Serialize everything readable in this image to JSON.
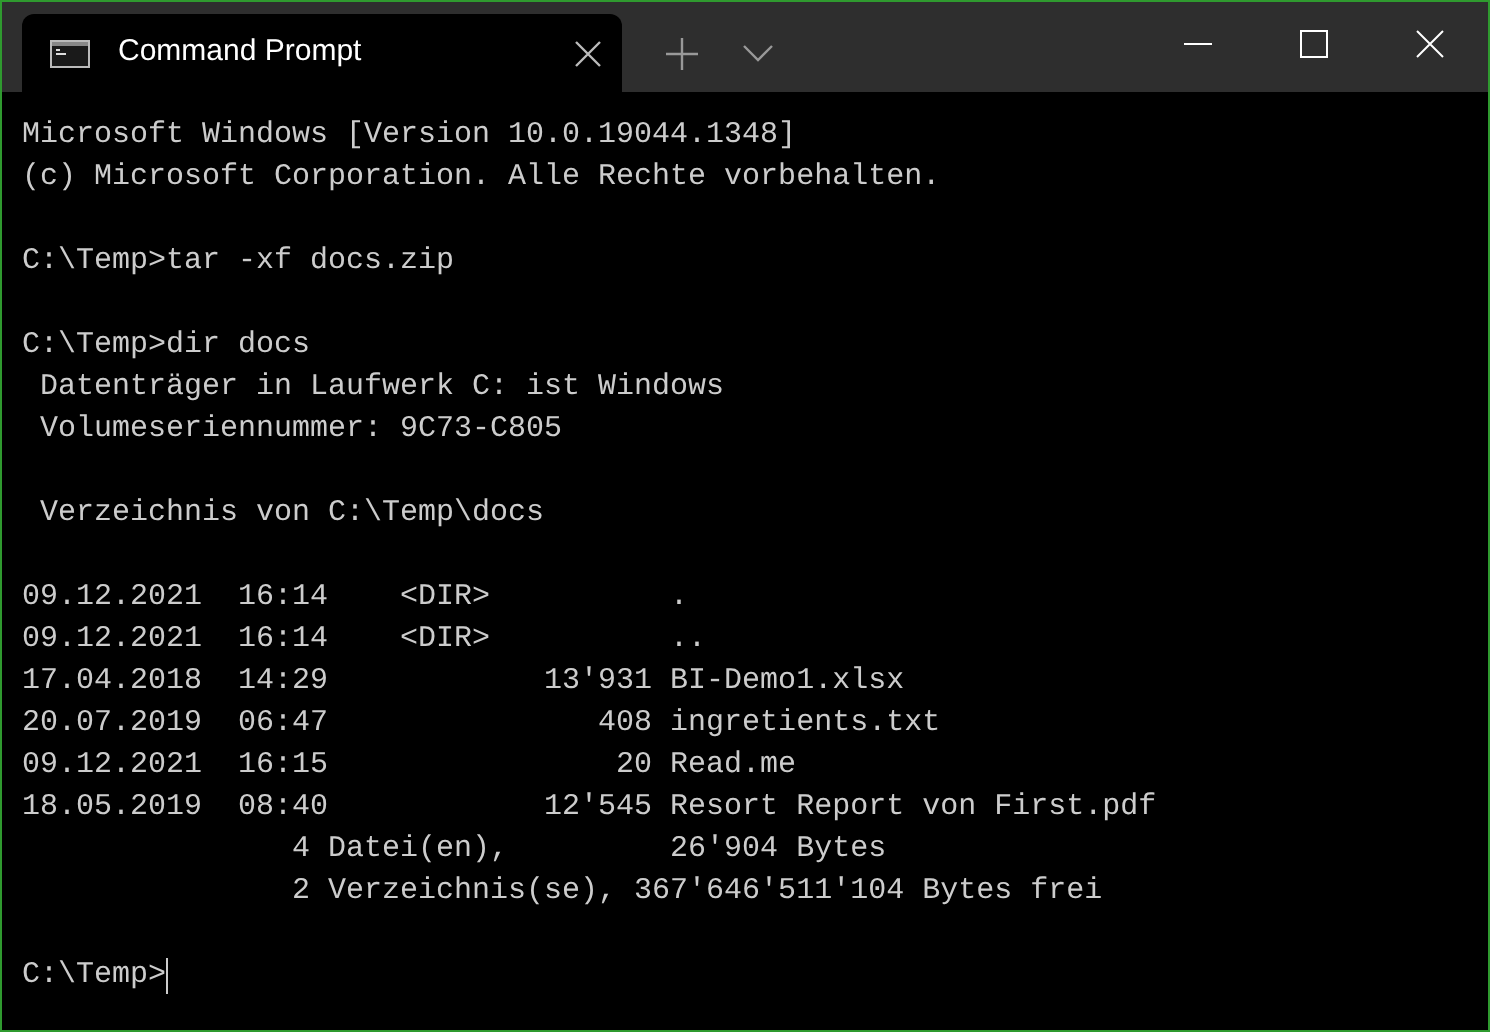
{
  "tab": {
    "title": "Command Prompt",
    "selected": true
  },
  "lines": [
    {
      "kind": "text",
      "text": "Microsoft Windows [Version 10.0.19044.1348]"
    },
    {
      "kind": "text",
      "text": "(c) Microsoft Corporation. Alle Rechte vorbehalten."
    },
    {
      "kind": "blank"
    },
    {
      "kind": "text",
      "text": "C:\\Temp>tar -xf docs.zip"
    },
    {
      "kind": "blank"
    },
    {
      "kind": "text",
      "text": "C:\\Temp>dir docs"
    },
    {
      "kind": "text",
      "text": " Datenträger in Laufwerk C: ist Windows"
    },
    {
      "kind": "text",
      "text": " Volumeseriennummer: 9C73-C805"
    },
    {
      "kind": "blank"
    },
    {
      "kind": "text",
      "text": " Verzeichnis von C:\\Temp\\docs"
    },
    {
      "kind": "blank"
    },
    {
      "kind": "text",
      "text": "09.12.2021  16:14    <DIR>          ."
    },
    {
      "kind": "text",
      "text": "09.12.2021  16:14    <DIR>          .."
    },
    {
      "kind": "text",
      "text": "17.04.2018  14:29            13'931 BI-Demo1.xlsx"
    },
    {
      "kind": "text",
      "text": "20.07.2019  06:47               408 ingretients.txt"
    },
    {
      "kind": "text",
      "text": "09.12.2021  16:15                20 Read.me"
    },
    {
      "kind": "text",
      "text": "18.05.2019  08:40            12'545 Resort Report von First.pdf"
    },
    {
      "kind": "text",
      "text": "               4 Datei(en),         26'904 Bytes"
    },
    {
      "kind": "text",
      "text": "               2 Verzeichnis(se), 367'646'511'104 Bytes frei"
    },
    {
      "kind": "blank"
    },
    {
      "kind": "prompt",
      "text": "C:\\Temp>",
      "cursor": true
    }
  ]
}
